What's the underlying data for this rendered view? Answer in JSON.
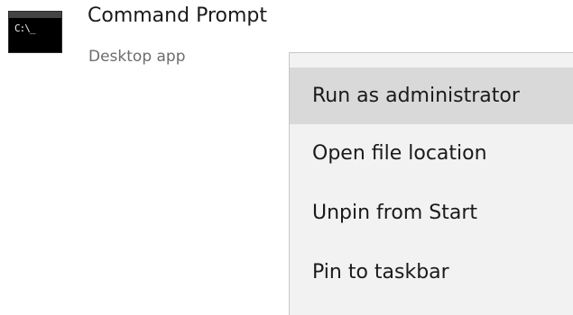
{
  "result": {
    "icon": "command-prompt-icon",
    "icon_text": "C:\\_",
    "title": "Command Prompt",
    "subtitle": "Desktop app"
  },
  "context_menu": {
    "items": [
      {
        "label": "Run as administrator",
        "highlighted": true
      },
      {
        "label": "Open file location",
        "highlighted": false
      },
      {
        "label": "Unpin from Start",
        "highlighted": false
      },
      {
        "label": "Pin to taskbar",
        "highlighted": false
      }
    ]
  },
  "colors": {
    "menu_background": "#f2f2f2",
    "menu_highlight": "#d9d9d9",
    "text": "#1a1a1a",
    "subtitle_text": "#6d6d6d"
  }
}
